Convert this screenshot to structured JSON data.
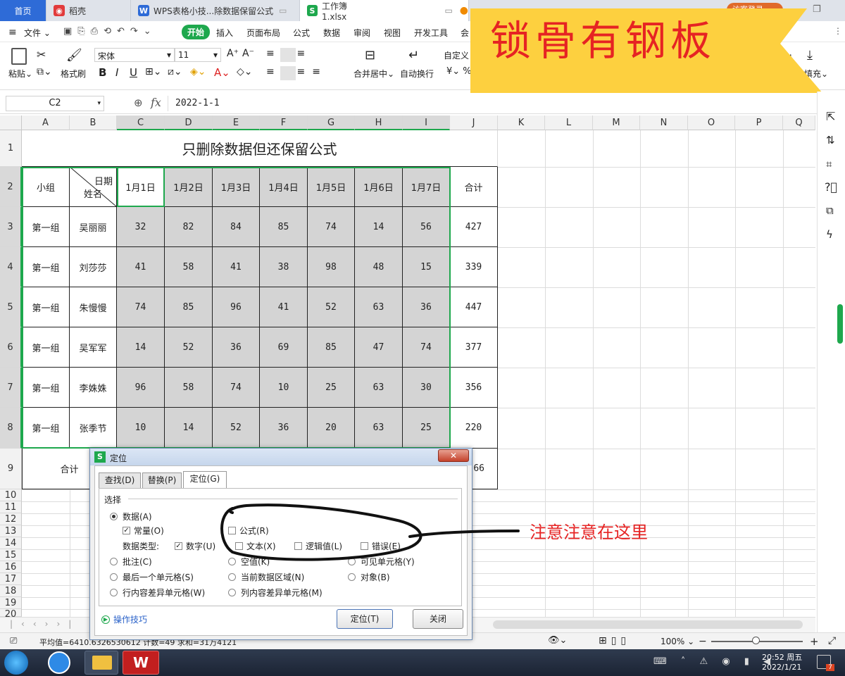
{
  "tabs": [
    {
      "label": "首页"
    },
    {
      "label": "稻壳"
    },
    {
      "label": "WPS表格小技...除数据保留公式"
    },
    {
      "label": "工作簿1.xlsx"
    }
  ],
  "login_label": "访客登录",
  "menu": [
    "文件",
    "开始",
    "插入",
    "页面布局",
    "公式",
    "数据",
    "审阅",
    "视图",
    "开发工具",
    "会"
  ],
  "ribbon": {
    "paste": "粘贴",
    "format_painter": "格式刷",
    "font_name": "宋体",
    "font_size": "11",
    "merge": "合并居中",
    "wrap": "自动换行",
    "number_format": "自定义",
    "fill": "填充"
  },
  "banner_text": "锁骨有钢板",
  "formula_bar": {
    "cell_ref": "C2",
    "fx": "fx",
    "value": "2022-1-1"
  },
  "columns": [
    "A",
    "B",
    "C",
    "D",
    "E",
    "F",
    "G",
    "H",
    "I",
    "J",
    "K",
    "L",
    "M",
    "N",
    "O",
    "P",
    "Q"
  ],
  "rows": [
    "1",
    "2",
    "3",
    "4",
    "5",
    "6",
    "7",
    "8",
    "9",
    "10",
    "11",
    "12",
    "13",
    "14",
    "15",
    "16",
    "17",
    "18",
    "19",
    "20"
  ],
  "sheet": {
    "title": "只删除数据但还保留公式",
    "header_group": "小组",
    "header_date": "日期",
    "header_name": "姓名",
    "dates": [
      "1月1日",
      "1月2日",
      "1月3日",
      "1月4日",
      "1月5日",
      "1月6日",
      "1月7日"
    ],
    "total_header": "合计",
    "data_rows": [
      {
        "group": "第一组",
        "name": "吴丽丽",
        "values": [
          "32",
          "82",
          "84",
          "85",
          "74",
          "14",
          "56"
        ],
        "total": "427"
      },
      {
        "group": "第一组",
        "name": "刘莎莎",
        "values": [
          "41",
          "58",
          "41",
          "38",
          "98",
          "48",
          "15"
        ],
        "total": "339"
      },
      {
        "group": "第一组",
        "name": "朱慢慢",
        "values": [
          "74",
          "85",
          "96",
          "41",
          "52",
          "63",
          "36"
        ],
        "total": "447"
      },
      {
        "group": "第一组",
        "name": "吴军军",
        "values": [
          "14",
          "52",
          "36",
          "69",
          "85",
          "47",
          "74"
        ],
        "total": "377"
      },
      {
        "group": "第一组",
        "name": "李姝姝",
        "values": [
          "96",
          "58",
          "74",
          "10",
          "25",
          "63",
          "30"
        ],
        "total": "356"
      },
      {
        "group": "第一组",
        "name": "张季节",
        "values": [
          "10",
          "14",
          "52",
          "36",
          "20",
          "63",
          "25"
        ],
        "total": "220"
      }
    ],
    "sum_label": "合计",
    "sum_total_partial": "66"
  },
  "dialog": {
    "title": "定位",
    "tabs": [
      "查找(D)",
      "替换(P)",
      "定位(G)"
    ],
    "section": "选择",
    "data_opt": "数据(A)",
    "constant": "常量(O)",
    "formula": "公式(R)",
    "data_type_label": "数据类型:",
    "number": "数字(U)",
    "text": "文本(X)",
    "logical": "逻辑值(L)",
    "error": "错误(E)",
    "comments": "批注(C)",
    "blanks": "空值(K)",
    "visible": "可见单元格(Y)",
    "last_cell": "最后一个单元格(S)",
    "current_region": "当前数据区域(N)",
    "objects": "对象(B)",
    "row_diff": "行内容差异单元格(W)",
    "col_diff": "列内容差异单元格(M)",
    "tips": "操作技巧",
    "ok": "定位(T)",
    "close": "关闭"
  },
  "annotation": "注意注意在这里",
  "status": {
    "stats": "平均值=6410.6326530612  计数=49  求和=31万4121",
    "zoom": "100%"
  },
  "taskbar": {
    "time": "20:52 周五",
    "date": "2022/1/21",
    "badge": "7"
  },
  "colors": {
    "accent_green": "#1ea84d",
    "home_tab_blue": "#2e6bd7",
    "banner": "#fdd03f",
    "annotation_red": "#e62323"
  }
}
